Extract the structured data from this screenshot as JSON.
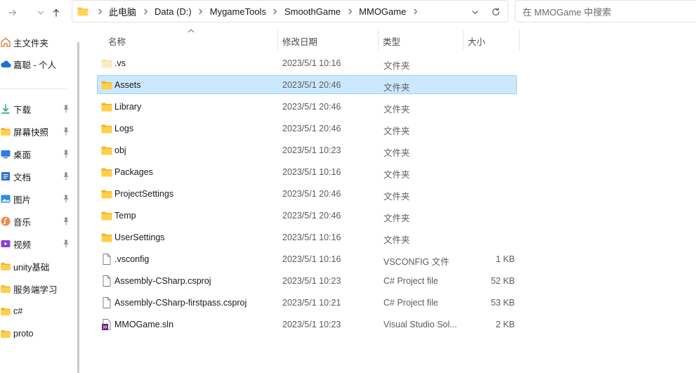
{
  "colors": {
    "accent": "#0067c0",
    "selection_bg": "#cce8ff",
    "selection_border": "#99d1ff",
    "folder": "#f8c73e",
    "text_secondary": "#5c5c5c"
  },
  "nav": {
    "forward_icon": "arrow-right-icon",
    "up_icon": "arrow-up-icon"
  },
  "address_bar": {
    "root_icon": "folder-icon",
    "breadcrumbs": [
      "此电脑",
      "Data (D:)",
      "MygameTools",
      "SmoothGame",
      "MMOGame"
    ],
    "dropdown_icon": "chevron-down-icon",
    "refresh_icon": "refresh-icon"
  },
  "search": {
    "placeholder": "在 MMOGame 中搜索",
    "value": ""
  },
  "sidebar": {
    "items": [
      {
        "label": "主文件夹",
        "icon": "home-icon",
        "pinned": false
      },
      {
        "label": "嘉聪 - 个人",
        "icon": "cloud-icon",
        "pinned": false
      },
      {
        "label": "下载",
        "icon": "download-icon",
        "pinned": true
      },
      {
        "label": "屏幕快照",
        "icon": "folder-icon",
        "pinned": true
      },
      {
        "label": "桌面",
        "icon": "desktop-icon",
        "pinned": true
      },
      {
        "label": "文档",
        "icon": "document-icon",
        "pinned": true
      },
      {
        "label": "图片",
        "icon": "picture-icon",
        "pinned": true
      },
      {
        "label": "音乐",
        "icon": "music-icon",
        "pinned": true
      },
      {
        "label": "视频",
        "icon": "video-icon",
        "pinned": true
      },
      {
        "label": "unity基础",
        "icon": "folder-icon",
        "pinned": false
      },
      {
        "label": "服务端学习",
        "icon": "folder-icon",
        "pinned": false
      },
      {
        "label": "c#",
        "icon": "folder-icon",
        "pinned": false
      },
      {
        "label": "proto",
        "icon": "folder-icon",
        "pinned": false
      }
    ]
  },
  "columns": {
    "name": "名称",
    "date": "修改日期",
    "type": "类型",
    "size": "大小"
  },
  "files": [
    {
      "name": ".vs",
      "date": "2023/5/1 10:16",
      "type": "文件夹",
      "size": "",
      "icon": "folder-faded-icon",
      "selected": false
    },
    {
      "name": "Assets",
      "date": "2023/5/1 20:46",
      "type": "文件夹",
      "size": "",
      "icon": "folder-icon",
      "selected": true
    },
    {
      "name": "Library",
      "date": "2023/5/1 20:46",
      "type": "文件夹",
      "size": "",
      "icon": "folder-icon",
      "selected": false
    },
    {
      "name": "Logs",
      "date": "2023/5/1 20:46",
      "type": "文件夹",
      "size": "",
      "icon": "folder-icon",
      "selected": false
    },
    {
      "name": "obj",
      "date": "2023/5/1 10:23",
      "type": "文件夹",
      "size": "",
      "icon": "folder-icon",
      "selected": false
    },
    {
      "name": "Packages",
      "date": "2023/5/1 10:16",
      "type": "文件夹",
      "size": "",
      "icon": "folder-icon",
      "selected": false
    },
    {
      "name": "ProjectSettings",
      "date": "2023/5/1 20:46",
      "type": "文件夹",
      "size": "",
      "icon": "folder-icon",
      "selected": false
    },
    {
      "name": "Temp",
      "date": "2023/5/1 20:46",
      "type": "文件夹",
      "size": "",
      "icon": "folder-icon",
      "selected": false
    },
    {
      "name": "UserSettings",
      "date": "2023/5/1 10:16",
      "type": "文件夹",
      "size": "",
      "icon": "folder-icon",
      "selected": false
    },
    {
      "name": ".vsconfig",
      "date": "2023/5/1 10:16",
      "type": "VSCONFIG 文件",
      "size": "1 KB",
      "icon": "file-icon",
      "selected": false
    },
    {
      "name": "Assembly-CSharp.csproj",
      "date": "2023/5/1 10:23",
      "type": "C# Project file",
      "size": "52 KB",
      "icon": "file-icon",
      "selected": false
    },
    {
      "name": "Assembly-CSharp-firstpass.csproj",
      "date": "2023/5/1 10:21",
      "type": "C# Project file",
      "size": "53 KB",
      "icon": "file-icon",
      "selected": false
    },
    {
      "name": "MMOGame.sln",
      "date": "2023/5/1 10:23",
      "type": "Visual Studio Sol...",
      "size": "2 KB",
      "icon": "visual-studio-solution-icon",
      "selected": false
    }
  ]
}
